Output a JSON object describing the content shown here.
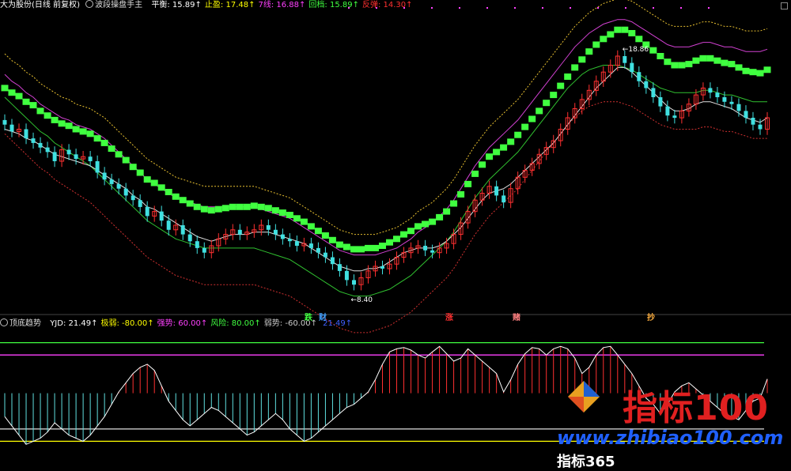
{
  "main_header": {
    "stock": "大为股份(日线 前复权)",
    "indicator": "波段操盘手主",
    "items": [
      {
        "label": "平衡:",
        "value": "15.89",
        "color": "#ffffff"
      },
      {
        "label": "止盈:",
        "value": "17.48",
        "color": "#ffff00"
      },
      {
        "label": "7线:",
        "value": "16.88",
        "color": "#ff40ff"
      },
      {
        "label": "回档:",
        "value": "15.89",
        "color": "#40ff40"
      },
      {
        "label": "反弹:",
        "value": "14.30",
        "color": "#ff3030"
      }
    ]
  },
  "sub_header": {
    "indicator": "顶底趋势",
    "items": [
      {
        "label": "YJD:",
        "value": "21.49",
        "color": "#ffffff"
      },
      {
        "label": "极弱:",
        "value": "-80.00",
        "color": "#ffff00"
      },
      {
        "label": "强势:",
        "value": "60.00",
        "color": "#ff40ff"
      },
      {
        "label": "风险:",
        "value": "80.00",
        "color": "#40ff40"
      },
      {
        "label": "弱势:",
        "value": "-60.00",
        "color": "#cccccc"
      },
      {
        "label": "",
        "value": "21.49",
        "color": "#4060ff"
      }
    ]
  },
  "signals": [
    {
      "text": "跌",
      "color": "#40ff40",
      "pos": 0.385
    },
    {
      "text": "财",
      "color": "#40a0ff",
      "pos": 0.403
    },
    {
      "text": "涨",
      "color": "#ff3030",
      "pos": 0.563
    },
    {
      "text": "赌",
      "color": "#ff8080",
      "pos": 0.648
    },
    {
      "text": "抄",
      "color": "#ffb040",
      "pos": 0.818
    }
  ],
  "price_annotations": {
    "high": "18.86",
    "low": "8.40"
  },
  "watermark": {
    "brand": "指标100",
    "site": "www.zhibiao100.com",
    "second": "指标365"
  },
  "chart_data": {
    "type": "candlestick",
    "note_panels": [
      "price",
      "oscillator"
    ],
    "price": {
      "ylim": [
        7.5,
        20.5
      ],
      "close": [
        15.6,
        15.3,
        15.4,
        15.0,
        14.8,
        14.6,
        14.4,
        14.0,
        14.5,
        14.3,
        14.1,
        14.2,
        14.0,
        13.5,
        13.2,
        13.0,
        12.8,
        12.5,
        12.3,
        12.0,
        11.6,
        11.8,
        11.4,
        11.0,
        11.2,
        10.8,
        10.5,
        10.2,
        10.0,
        10.3,
        10.6,
        10.8,
        11.0,
        10.8,
        10.9,
        11.0,
        11.2,
        11.0,
        10.8,
        10.6,
        10.5,
        10.3,
        10.4,
        10.2,
        10.0,
        9.8,
        9.5,
        9.2,
        8.8,
        8.6,
        8.9,
        9.2,
        9.4,
        9.3,
        9.5,
        9.8,
        10.0,
        10.2,
        10.3,
        10.1,
        10.0,
        10.2,
        10.4,
        10.8,
        11.3,
        11.8,
        12.3,
        12.6,
        12.9,
        12.5,
        12.2,
        12.8,
        13.3,
        13.6,
        13.9,
        14.3,
        14.6,
        14.9,
        15.4,
        15.9,
        16.3,
        16.7,
        17.1,
        17.5,
        17.9,
        18.2,
        18.6,
        18.3,
        17.9,
        17.5,
        17.2,
        16.8,
        16.4,
        16.0,
        15.9,
        16.2,
        16.5,
        16.9,
        17.2,
        17.0,
        16.8,
        16.6,
        16.5,
        16.2,
        15.9,
        15.6,
        15.4,
        15.9
      ],
      "high_annot_index": 86,
      "low_annot_index": 49,
      "ma_white": [
        15.4,
        15.3,
        15.2,
        15.0,
        14.9,
        14.7,
        14.5,
        14.3,
        14.2,
        14.1,
        14.0,
        13.9,
        13.8,
        13.6,
        13.4,
        13.2,
        13.0,
        12.8,
        12.5,
        12.3,
        12.0,
        11.9,
        11.7,
        11.5,
        11.3,
        11.1,
        10.9,
        10.7,
        10.6,
        10.5,
        10.6,
        10.7,
        10.8,
        10.8,
        10.8,
        10.9,
        10.9,
        10.9,
        10.8,
        10.7,
        10.6,
        10.5,
        10.4,
        10.2,
        10.0,
        9.8,
        9.6,
        9.4,
        9.3,
        9.2,
        9.2,
        9.3,
        9.3,
        9.4,
        9.6,
        9.8,
        10.0,
        10.1,
        10.2,
        10.2,
        10.2,
        10.3,
        10.5,
        10.8,
        11.1,
        11.5,
        11.9,
        12.3,
        12.6,
        12.7,
        12.8,
        13.0,
        13.3,
        13.6,
        13.9,
        14.2,
        14.5,
        14.8,
        15.2,
        15.6,
        16.0,
        16.4,
        16.8,
        17.2,
        17.5,
        17.8,
        18.1,
        18.1,
        17.9,
        17.6,
        17.3,
        17.0,
        16.7,
        16.4,
        16.2,
        16.2,
        16.3,
        16.5,
        16.6,
        16.6,
        16.5,
        16.4,
        16.3,
        16.1,
        15.9,
        15.8,
        15.7,
        15.9
      ],
      "upper_magenta": [
        17.8,
        17.5,
        17.3,
        17.0,
        16.8,
        16.5,
        16.3,
        16.1,
        15.9,
        15.8,
        15.6,
        15.5,
        15.4,
        15.2,
        15.0,
        14.7,
        14.4,
        14.1,
        13.8,
        13.5,
        13.2,
        13.0,
        12.8,
        12.6,
        12.4,
        12.3,
        12.2,
        12.1,
        12.0,
        12.0,
        12.0,
        12.0,
        12.0,
        12.0,
        12.0,
        12.0,
        11.9,
        11.8,
        11.7,
        11.6,
        11.5,
        11.3,
        11.1,
        10.9,
        10.7,
        10.5,
        10.3,
        10.1,
        10.0,
        9.9,
        9.9,
        9.9,
        9.9,
        10.0,
        10.1,
        10.2,
        10.4,
        10.6,
        10.9,
        11.1,
        11.3,
        11.6,
        11.9,
        12.3,
        12.8,
        13.3,
        13.8,
        14.2,
        14.6,
        14.9,
        15.2,
        15.5,
        15.8,
        16.2,
        16.6,
        17.0,
        17.4,
        17.8,
        18.2,
        18.6,
        19.0,
        19.3,
        19.6,
        19.8,
        20.0,
        20.1,
        20.2,
        20.2,
        20.1,
        19.9,
        19.7,
        19.5,
        19.3,
        19.1,
        19.0,
        19.0,
        19.0,
        19.1,
        19.2,
        19.2,
        19.1,
        19.0,
        19.0,
        18.9,
        18.8,
        18.8,
        18.8,
        18.9
      ],
      "mid_green": [
        16.8,
        16.5,
        16.2,
        15.9,
        15.6,
        15.3,
        15.1,
        14.8,
        14.6,
        14.4,
        14.2,
        14.0,
        13.8,
        13.5,
        13.2,
        12.9,
        12.6,
        12.3,
        12.0,
        11.7,
        11.4,
        11.2,
        11.0,
        10.8,
        10.6,
        10.5,
        10.4,
        10.3,
        10.2,
        10.2,
        10.2,
        10.2,
        10.2,
        10.2,
        10.2,
        10.2,
        10.1,
        10.0,
        9.9,
        9.8,
        9.7,
        9.5,
        9.3,
        9.1,
        8.9,
        8.7,
        8.5,
        8.3,
        8.2,
        8.1,
        8.1,
        8.1,
        8.2,
        8.3,
        8.4,
        8.6,
        8.8,
        9.0,
        9.3,
        9.6,
        9.9,
        10.2,
        10.5,
        10.9,
        11.4,
        11.9,
        12.4,
        12.8,
        13.2,
        13.5,
        13.8,
        14.1,
        14.4,
        14.8,
        15.2,
        15.6,
        16.0,
        16.4,
        16.8,
        17.2,
        17.5,
        17.8,
        18.0,
        18.1,
        18.2,
        18.2,
        18.2,
        18.1,
        18.0,
        17.8,
        17.6,
        17.4,
        17.2,
        17.1,
        17.0,
        17.0,
        17.0,
        17.0,
        17.1,
        17.1,
        17.0,
        16.9,
        16.9,
        16.8,
        16.7,
        16.6,
        16.6,
        16.6
      ]
    },
    "oscillator": {
      "ylim": [
        -100,
        100
      ],
      "levels": [
        {
          "name": "风险",
          "value": 80,
          "color": "#40ff40"
        },
        {
          "name": "强势",
          "value": 60,
          "color": "#ff40ff"
        },
        {
          "name": "弱势",
          "value": -60,
          "color": "#cccccc"
        },
        {
          "name": "极弱",
          "value": -80,
          "color": "#ffff00"
        }
      ],
      "values": [
        -40,
        -55,
        -70,
        -85,
        -80,
        -75,
        -65,
        -50,
        -60,
        -70,
        -75,
        -80,
        -70,
        -55,
        -40,
        -20,
        0,
        15,
        30,
        40,
        45,
        35,
        10,
        -15,
        -30,
        -45,
        -55,
        -45,
        -35,
        -25,
        -30,
        -40,
        -50,
        -60,
        -70,
        -65,
        -55,
        -45,
        -35,
        -45,
        -60,
        -70,
        -80,
        -75,
        -65,
        -55,
        -45,
        -35,
        -25,
        -20,
        -10,
        0,
        20,
        45,
        65,
        70,
        72,
        68,
        60,
        55,
        65,
        74,
        62,
        50,
        55,
        70,
        60,
        50,
        40,
        30,
        0,
        20,
        45,
        62,
        72,
        70,
        60,
        70,
        74,
        70,
        55,
        30,
        40,
        60,
        72,
        74,
        60,
        45,
        30,
        10,
        -10,
        -20,
        -35,
        -20,
        0,
        10,
        15,
        5,
        -5,
        -15,
        -25,
        -35,
        -40,
        -45,
        -30,
        -15,
        -10,
        21
      ]
    }
  }
}
